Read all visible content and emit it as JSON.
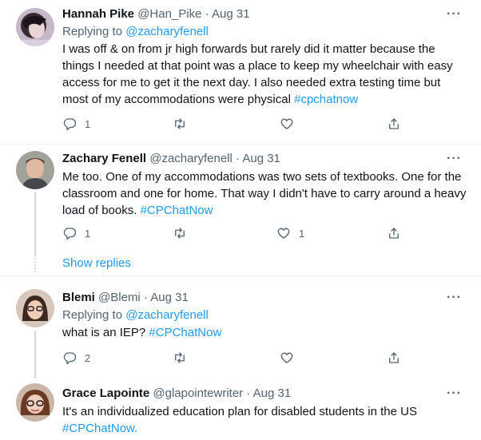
{
  "tweets": [
    {
      "name": "Hannah Pike",
      "handle": "@Han_Pike",
      "dot": "·",
      "date": "Aug 31",
      "replying_label": "Replying to",
      "replying_to": "@zacharyfenell",
      "text": "I was off & on from jr high forwards but rarely did it matter because the things I needed at that point was a place to keep my wheelchair with easy access for me to get it the next day. I also needed extra testing time but most of my accommodations were physical",
      "hashtag": "#cpchatnow",
      "reply_count": "1",
      "retweet_count": "",
      "like_count": "",
      "more": "···"
    },
    {
      "name": "Zachary Fenell",
      "handle": "@zacharyfenell",
      "dot": "·",
      "date": "Aug 31",
      "text": "Me too. One of my accommodations was two sets of textbooks. One for the classroom and one for home. That way I didn't have to carry around a heavy load of books.",
      "hashtag": "#CPChatNow",
      "reply_count": "1",
      "retweet_count": "",
      "like_count": "1",
      "more": "···"
    },
    {
      "name": "Blemi",
      "handle": "@Blemi",
      "dot": "·",
      "date": "Aug 31",
      "replying_label": "Replying to",
      "replying_to": "@zacharyfenell",
      "text": "what is an IEP?",
      "hashtag": "#CPChatNow",
      "reply_count": "2",
      "retweet_count": "",
      "like_count": "",
      "more": "···"
    },
    {
      "name": "Grace Lapointe",
      "handle": "@glapointewriter",
      "dot": "·",
      "date": "Aug 31",
      "text": "It's an individualized education plan for disabled students in the US",
      "hashtag": "#CPChatNow.",
      "more": "···"
    }
  ],
  "show_replies": "Show replies",
  "icons": [
    "reply-icon",
    "retweet-icon",
    "like-icon",
    "share-icon",
    "more-icon"
  ],
  "colors": {
    "accent": "#1d9bf0",
    "secondary": "#536471",
    "divider": "#eff3f4",
    "thread": "#cfd9de"
  }
}
